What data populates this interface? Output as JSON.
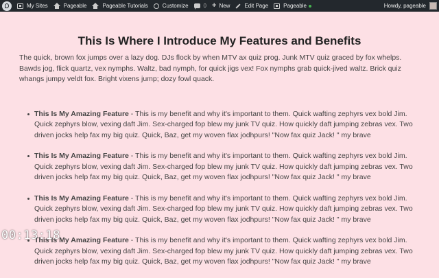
{
  "adminbar": {
    "my_sites": "My Sites",
    "site_name": "Pageable",
    "tutorials": "Pageable Tutorials",
    "customize": "Customize",
    "comments_count": "0",
    "new": "New",
    "edit_page": "Edit Page",
    "plugin": "Pageable",
    "greeting": "Howdy, pageable"
  },
  "page": {
    "title": "This Is Where I Introduce My Features and Benefits",
    "intro": "The quick, brown fox jumps over a lazy dog. DJs flock by when MTV ax quiz prog. Junk MTV quiz graced by fox whelps. Bawds jog, flick quartz, vex nymphs. Waltz, bad nymph, for quick jigs vex! Fox nymphs grab quick-jived waltz. Brick quiz whangs jumpy veldt fox. Bright vixens jump; dozy fowl quack.",
    "features": [
      {
        "name": "This Is My Amazing Feature",
        "text": " - This is my benefit and why it's important to them. Quick wafting zephyrs vex bold Jim. Quick zephyrs blow, vexing daft Jim. Sex-charged fop blew my junk TV quiz. How quickly daft jumping zebras vex. Two driven jocks help fax my big quiz. Quick, Baz, get my woven flax jodhpurs! \"Now fax quiz Jack! \" my brave"
      },
      {
        "name": "This Is My Amazing Feature",
        "text": " - This is my benefit and why it's important to them. Quick wafting zephyrs vex bold Jim. Quick zephyrs blow, vexing daft Jim. Sex-charged fop blew my junk TV quiz. How quickly daft jumping zebras vex. Two driven jocks help fax my big quiz. Quick, Baz, get my woven flax jodhpurs! \"Now fax quiz Jack! \" my brave"
      },
      {
        "name": "This Is My Amazing Feature",
        "text": " - This is my benefit and why it's important to them. Quick wafting zephyrs vex bold Jim. Quick zephyrs blow, vexing daft Jim. Sex-charged fop blew my junk TV quiz. How quickly daft jumping zebras vex. Two driven jocks help fax my big quiz. Quick, Baz, get my woven flax jodhpurs! \"Now fax quiz Jack! \" my brave"
      },
      {
        "name": "This Is My Amazing Feature",
        "text": " - This is my benefit and why it's important to them. Quick wafting zephyrs vex bold Jim. Quick zephyrs blow, vexing daft Jim. Sex-charged fop blew my junk TV quiz. How quickly daft jumping zebras vex. Two driven jocks help fax my big quiz. Quick, Baz, get my woven flax jodhpurs! \"Now fax quiz Jack! \" my brave"
      }
    ]
  },
  "timestamp": "00:13:18",
  "colors": {
    "background": "#fde0e5",
    "adminbar": "#23282d",
    "status_dot": "#46b450"
  },
  "icons": {
    "logo": "wordpress-logo-icon",
    "my_sites": "my-sites-icon",
    "site": "home-icon",
    "customize": "customize-brush-icon",
    "comments": "comment-bubble-icon",
    "new": "plus-icon",
    "edit": "pencil-icon"
  }
}
